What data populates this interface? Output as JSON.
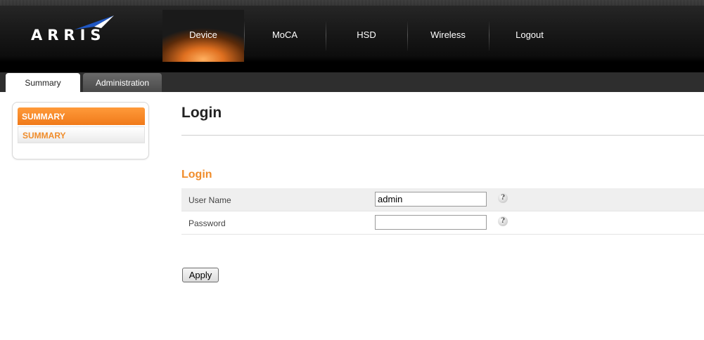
{
  "header": {
    "logo_text": "ARRIS",
    "nav": [
      {
        "label": "Device",
        "active": true
      },
      {
        "label": "MoCA",
        "active": false
      },
      {
        "label": "HSD",
        "active": false
      },
      {
        "label": "Wireless",
        "active": false
      },
      {
        "label": "Logout",
        "active": false
      }
    ],
    "accent": "#f08c2a"
  },
  "tabs": [
    {
      "label": "Summary",
      "active": true
    },
    {
      "label": "Administration",
      "active": false
    }
  ],
  "sidebar": {
    "heading": "SUMMARY",
    "items": [
      {
        "label": "SUMMARY"
      }
    ]
  },
  "main": {
    "title": "Login",
    "section_title": "Login",
    "fields": [
      {
        "label": "User Name",
        "value": "admin",
        "help_icon": "?"
      },
      {
        "label": "Password",
        "value": "",
        "help_icon": "?"
      }
    ],
    "apply_label": "Apply"
  }
}
